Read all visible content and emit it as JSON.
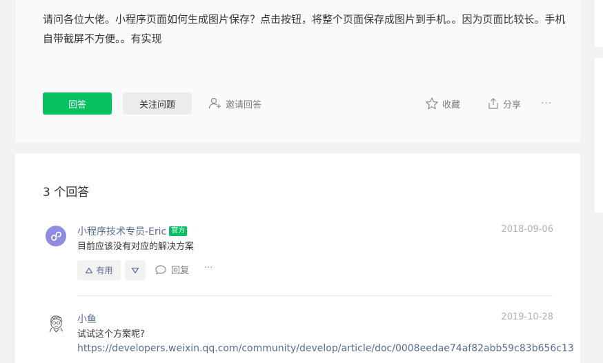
{
  "question": {
    "text": "请问各位大佬。小程序页面如何生成图片保存？点击按钮，将整个页面保存成图片到手机。。因为页面比较长。手机自带截屏不方便。。有实现",
    "answer_button": "回答",
    "follow_button": "关注问题",
    "invite_label": "邀请回答",
    "collect_label": "收藏",
    "share_label": "分享",
    "more_label": "···"
  },
  "answers": {
    "count_label": "3 个回答",
    "items": [
      {
        "author": "小程序技术专员-Eric",
        "badge": "官方",
        "date": "2018-09-06",
        "content": "目前应该没有对应的解决方案",
        "useful_label": "有用",
        "reply_label": "回复",
        "more_label": "···"
      },
      {
        "author": "小鱼",
        "date": "2019-10-28",
        "content": "试试这个方案呢?",
        "link": "https://developers.weixin.qq.com/community/develop/article/doc/0008eedae74af82abb59c83b656c13"
      }
    ]
  },
  "colors": {
    "primary": "#07c160",
    "link": "#576b95",
    "muted": "#b2b2b2"
  }
}
